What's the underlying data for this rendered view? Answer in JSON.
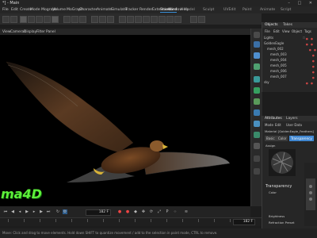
{
  "window": {
    "title": "*] - Main",
    "controls": "– □ ✕"
  },
  "menu": {
    "items": [
      "File",
      "Edit",
      "Create",
      "Mode",
      "Mograph",
      "Volume",
      "MoGraph",
      "Character",
      "Animate",
      "Simulate",
      "Tracker",
      "Render",
      "Extensions",
      "Window",
      "Help"
    ]
  },
  "layouts": {
    "tabs": [
      "Standard",
      "Model",
      "Sculpt",
      "UVEdit",
      "Paint",
      "Animate",
      "Script"
    ],
    "active": "Standard"
  },
  "viewport_menu": {
    "items": [
      "View",
      "Cameras",
      "Display",
      "Filter",
      "Panel"
    ]
  },
  "watermark": {
    "text": "ma4D"
  },
  "timeline": {
    "current_frame": "182 F",
    "end_frame": "182 F"
  },
  "status": {
    "text": "Move: Click and drag to move elements. Hold down SHIFT to quantize movement / add to the selection in point mode, CTRL to remove."
  },
  "objects": {
    "tabs": [
      "Objects",
      "Takes"
    ],
    "menu": [
      "File",
      "Edit",
      "View",
      "Object",
      "Tags"
    ],
    "rows": [
      {
        "label": "Lights",
        "indent": 0
      },
      {
        "label": "GoldenEagle",
        "indent": 0
      },
      {
        "label": "mesh_002",
        "indent": 1
      },
      {
        "label": "mesh_003",
        "indent": 2
      },
      {
        "label": "mesh_004",
        "indent": 2
      },
      {
        "label": "mesh_005",
        "indent": 2
      },
      {
        "label": "mesh_006",
        "indent": 2
      },
      {
        "label": "mesh_007",
        "indent": 2
      },
      {
        "label": "sky",
        "indent": 0
      }
    ]
  },
  "attributes": {
    "tabs": [
      "Attributes",
      "Layers"
    ],
    "menu": [
      "Mode",
      "Edit",
      "User Data"
    ],
    "material_label": "Material [GoldenEagle_Feathers]",
    "channel_tabs": [
      "Basic",
      "Color",
      "Transparency"
    ],
    "active_channel": "Transparency",
    "preview_label": "Assign",
    "section_title": "Transparency",
    "color_label": "Color",
    "brightness_label": "Brightness",
    "refraction_label": "Refraction Preset"
  },
  "colors": {
    "accent": "#3f86d0",
    "watermark": "#5df03a"
  }
}
